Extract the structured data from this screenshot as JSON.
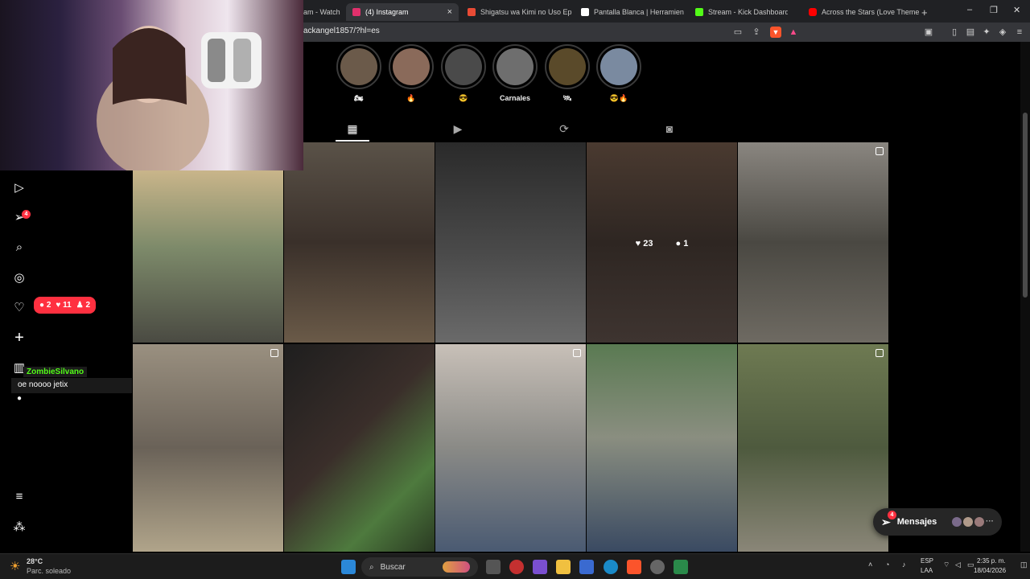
{
  "browser": {
    "tabs": [
      {
        "title": "am - Watch",
        "color": "#9146ff",
        "active": false
      },
      {
        "title": "(4) Instagram",
        "color": "#e1306c",
        "active": true
      },
      {
        "title": "Shigatsu wa Kimi no Uso Episo",
        "color": "#e94b35",
        "active": false
      },
      {
        "title": "Pantalla Blanca | Herramienta d",
        "color": "#ffffff",
        "active": false
      },
      {
        "title": "Stream - Kick Dashboard",
        "color": "#53fc18",
        "active": false
      },
      {
        "title": "Across the Stars (Love Theme f",
        "color": "#ff0000",
        "active": false
      }
    ],
    "new_tab": "+",
    "url": "ackangel1857/?hl=es"
  },
  "stories": [
    {
      "label": "🏍",
      "color": "#6b5a4a"
    },
    {
      "label": "🔥",
      "color": "#8a6a5a"
    },
    {
      "label": "😎",
      "color": "#4a4a4a"
    },
    {
      "label": "Carnales",
      "color": "#6e6e6e"
    },
    {
      "label": "🛰",
      "color": "#5a4a2a"
    },
    {
      "label": "😎🔥",
      "color": "#7a8aa0"
    }
  ],
  "profile_tabs": [
    "posts",
    "reels",
    "reposts",
    "tagged"
  ],
  "posts": [
    {
      "color": "#5c6a58",
      "marked": false
    },
    {
      "color": "#4a4038",
      "marked": false
    },
    {
      "color": "#3c3c3c",
      "marked": false
    },
    {
      "color": "#3a3028",
      "marked": false,
      "likes": "23",
      "comments": "1"
    },
    {
      "color": "#5e5a52",
      "marked": true
    },
    {
      "color": "#8a8072",
      "marked": true
    },
    {
      "color": "#3e5a36",
      "marked": false
    },
    {
      "color": "#9a9088",
      "marked": true
    },
    {
      "color": "#5a6a4e",
      "marked": false
    },
    {
      "color": "#6a6a52",
      "marked": true
    }
  ],
  "sidebar": {
    "notification_count": "4",
    "activity": {
      "comments": "2",
      "likes": "11",
      "follows": "2"
    }
  },
  "chat": {
    "username": "ZombieSilvano",
    "message": "oe noooo jetix"
  },
  "messages_pill": {
    "label": "Mensajes",
    "badge": "4"
  },
  "taskbar": {
    "weather_temp": "28°C",
    "weather_desc": "Parc. soleado",
    "search_placeholder": "Buscar",
    "language": "ESP",
    "keyboard": "LAA",
    "time": "2:35 p. m.",
    "date": "18/04/2026"
  }
}
